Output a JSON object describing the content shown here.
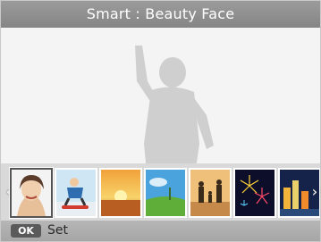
{
  "title": "Smart : Beauty Face",
  "filmstrip": {
    "left_arrow": "‹",
    "right_arrow": "›",
    "scenes": [
      {
        "name": "beauty-face",
        "selected": true
      },
      {
        "name": "action"
      },
      {
        "name": "sunset"
      },
      {
        "name": "landscape"
      },
      {
        "name": "backlight"
      },
      {
        "name": "fireworks"
      },
      {
        "name": "night-city"
      }
    ]
  },
  "footer": {
    "ok_key": "OK",
    "action_label": "Set"
  }
}
